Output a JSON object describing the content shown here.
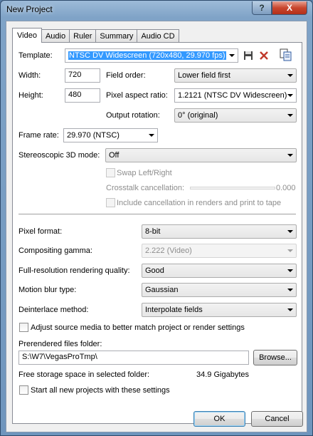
{
  "window": {
    "title": "New Project"
  },
  "titlebar": {
    "help_label": "?",
    "close_label": "X"
  },
  "tabs": [
    {
      "label": "Video"
    },
    {
      "label": "Audio"
    },
    {
      "label": "Ruler"
    },
    {
      "label": "Summary"
    },
    {
      "label": "Audio CD"
    }
  ],
  "video": {
    "template_label": "Template:",
    "template_value": "NTSC DV Widescreen (720x480, 29.970 fps)",
    "width_label": "Width:",
    "width_value": "720",
    "height_label": "Height:",
    "height_value": "480",
    "field_order_label": "Field order:",
    "field_order_value": "Lower field first",
    "pixel_aspect_label": "Pixel aspect ratio:",
    "pixel_aspect_value": "1.2121 (NTSC DV Widescreen)",
    "output_rotation_label": "Output rotation:",
    "output_rotation_value": "0° (original)",
    "frame_rate_label": "Frame rate:",
    "frame_rate_value": "29.970 (NTSC)",
    "stereo_label": "Stereoscopic 3D mode:",
    "stereo_value": "Off",
    "swap_lr_label": "Swap Left/Right",
    "crosstalk_label": "Crosstalk cancellation:",
    "crosstalk_value": "0.000",
    "include_cancel_label": "Include cancellation in renders and print to tape",
    "pixel_format_label": "Pixel format:",
    "pixel_format_value": "8-bit",
    "gamma_label": "Compositing gamma:",
    "gamma_value": "2.222 (Video)",
    "fullres_label": "Full-resolution rendering quality:",
    "fullres_value": "Good",
    "motion_blur_label": "Motion blur type:",
    "motion_blur_value": "Gaussian",
    "deinterlace_label": "Deinterlace method:",
    "deinterlace_value": "Interpolate fields",
    "adjust_source_label": "Adjust source media to better match project or render settings",
    "prerendered_label": "Prerendered files folder:",
    "prerendered_value": "S:\\W7\\VegasProTmp\\",
    "browse_label": "Browse...",
    "free_space_label": "Free storage space in selected folder:",
    "free_space_value": "34.9 Gigabytes",
    "start_all_label": "Start all new projects with these settings"
  },
  "footer": {
    "ok_label": "OK",
    "cancel_label": "Cancel"
  },
  "icons": {
    "save": "save-icon",
    "delete": "delete-icon",
    "copy": "copy-settings-icon"
  },
  "colors": {
    "selection": "#3399ff",
    "delete_red": "#c0392b"
  }
}
